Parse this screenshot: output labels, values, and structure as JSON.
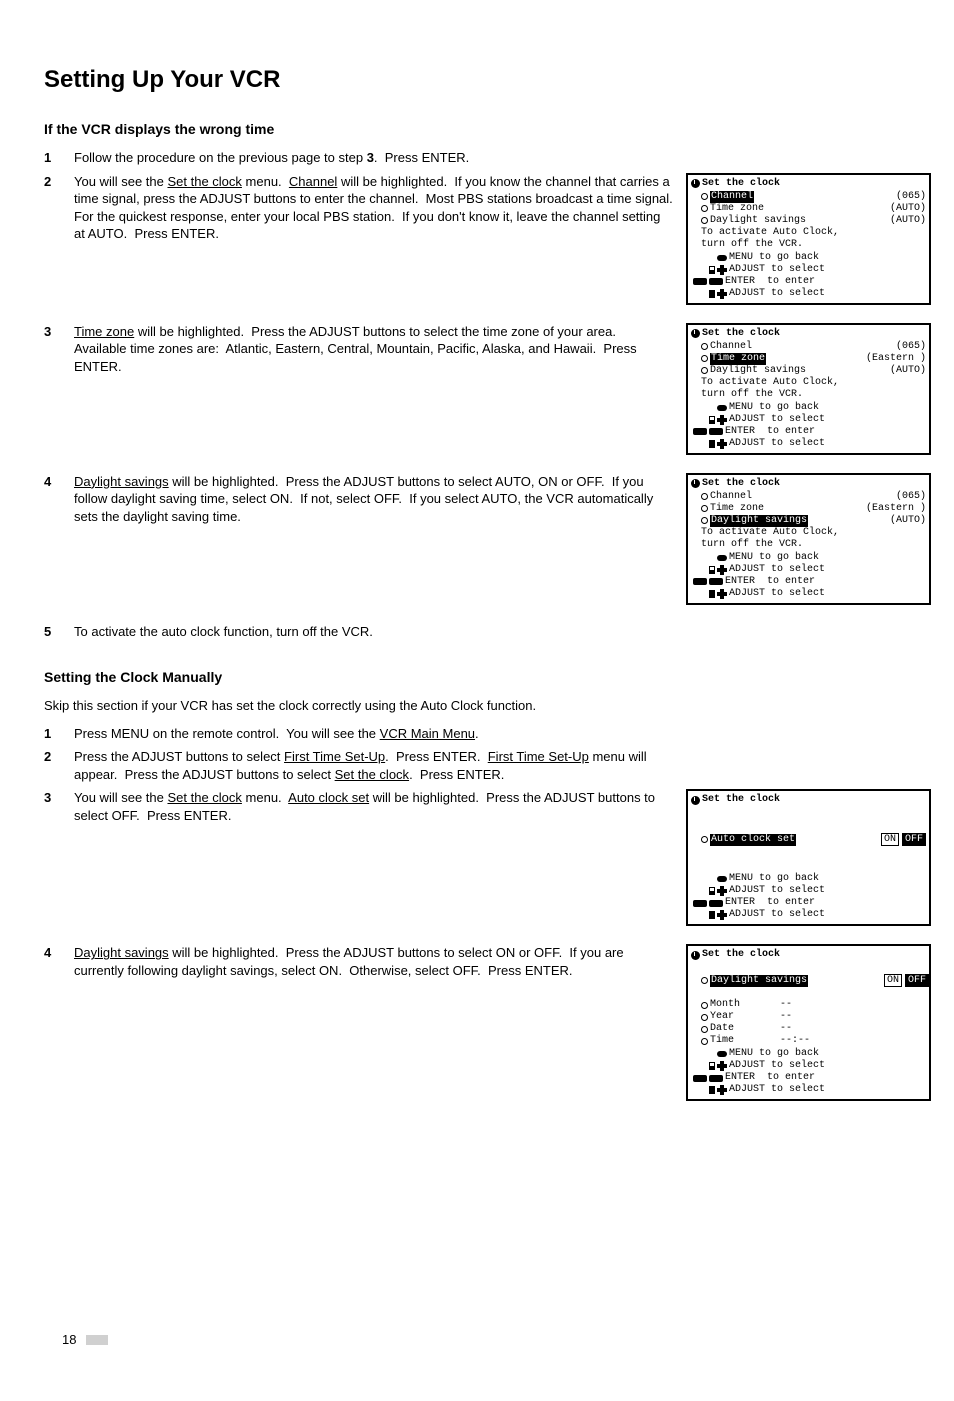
{
  "page_title": "Setting Up Your VCR",
  "wrong_time_heading": "If the VCR displays the wrong time",
  "steps_wrong_time": {
    "s1": {
      "num": "1",
      "parts": [
        "Follow the procedure on the previous page to step ",
        "3",
        ".  Press ENTER."
      ]
    },
    "s2": {
      "num": "2",
      "parts": [
        "You will see the ",
        "Set the clock",
        " menu.  ",
        "Channel",
        " will be highlighted.  If you know the channel that carries a time signal, press the ADJUST buttons to enter the channel.  Most PBS stations broadcast a time signal.  For the quickest response, enter your local PBS station.  If you don't know it, leave the channel setting at AUTO.  Press ENTER."
      ]
    },
    "s3": {
      "num": "3",
      "parts": [
        "Time zone",
        " will be highlighted.  Press the ADJUST buttons to select the time zone of your area.  Available time zones are:  Atlantic, Eastern, Central, Mountain, Pacific, Alaska, and Hawaii.  Press ENTER."
      ]
    },
    "s4": {
      "num": "4",
      "parts": [
        "Daylight savings",
        " will be highlighted.  Press the ADJUST buttons to select AUTO, ON or OFF.  If you follow daylight saving time, select ON.  If not, select OFF.  If you select AUTO, the VCR automatically sets the daylight saving time."
      ]
    },
    "s5": {
      "num": "5",
      "parts": [
        "To activate the auto clock function, turn off the VCR."
      ]
    }
  },
  "manual_heading": "Setting the Clock Manually",
  "manual_intro": "Skip this section if your VCR has set the clock correctly using the Auto Clock function.",
  "steps_manual": {
    "s1": {
      "num": "1",
      "parts": [
        "Press MENU on the remote control.  You will see the ",
        "VCR Main Menu",
        "."
      ]
    },
    "s2": {
      "num": "2",
      "parts": [
        "Press the ADJUST buttons to select ",
        "First Time Set-Up",
        ".  Press ENTER.  ",
        "First Time Set-Up",
        " menu will appear.  Press the ADJUST buttons to select ",
        "Set the clock",
        ".  Press ENTER."
      ]
    },
    "s3": {
      "num": "3",
      "parts": [
        "You will see the ",
        "Set the clock",
        " menu.  ",
        "Auto clock set",
        " will be highlighted.  Press the ADJUST buttons to select OFF.  Press ENTER."
      ]
    },
    "s4": {
      "num": "4",
      "parts": [
        "Daylight savings",
        " will be highlighted.  Press the ADJUST buttons to select ON or OFF.  If you are currently following daylight savings, select ON.  Otherwise, select OFF.  Press ENTER."
      ]
    }
  },
  "osd": {
    "title": "Set the clock",
    "ch_label": "Channel",
    "tz_label": "Time zone",
    "ds_label": "Daylight savings",
    "auto_clock_label": "Auto clock set",
    "month_label": "Month",
    "year_label": "Year",
    "date_label": "Date",
    "time_label": "Time",
    "val_065": "(065)",
    "val_auto": "(AUTO)",
    "val_eastern": "(Eastern )",
    "val_dash": "--",
    "val_time_blank": "--:--",
    "msg_activate_line1": "To activate Auto Clock,",
    "msg_activate_line2": "turn off the VCR.",
    "hint_menu": "MENU to go back",
    "hint_adj_sel": "ADJUST to select",
    "hint_enter": "ENTER  to enter",
    "hint_adj_sel2": "ADJUST to select",
    "on": "ON",
    "off": "OFF"
  },
  "page_number": "18"
}
